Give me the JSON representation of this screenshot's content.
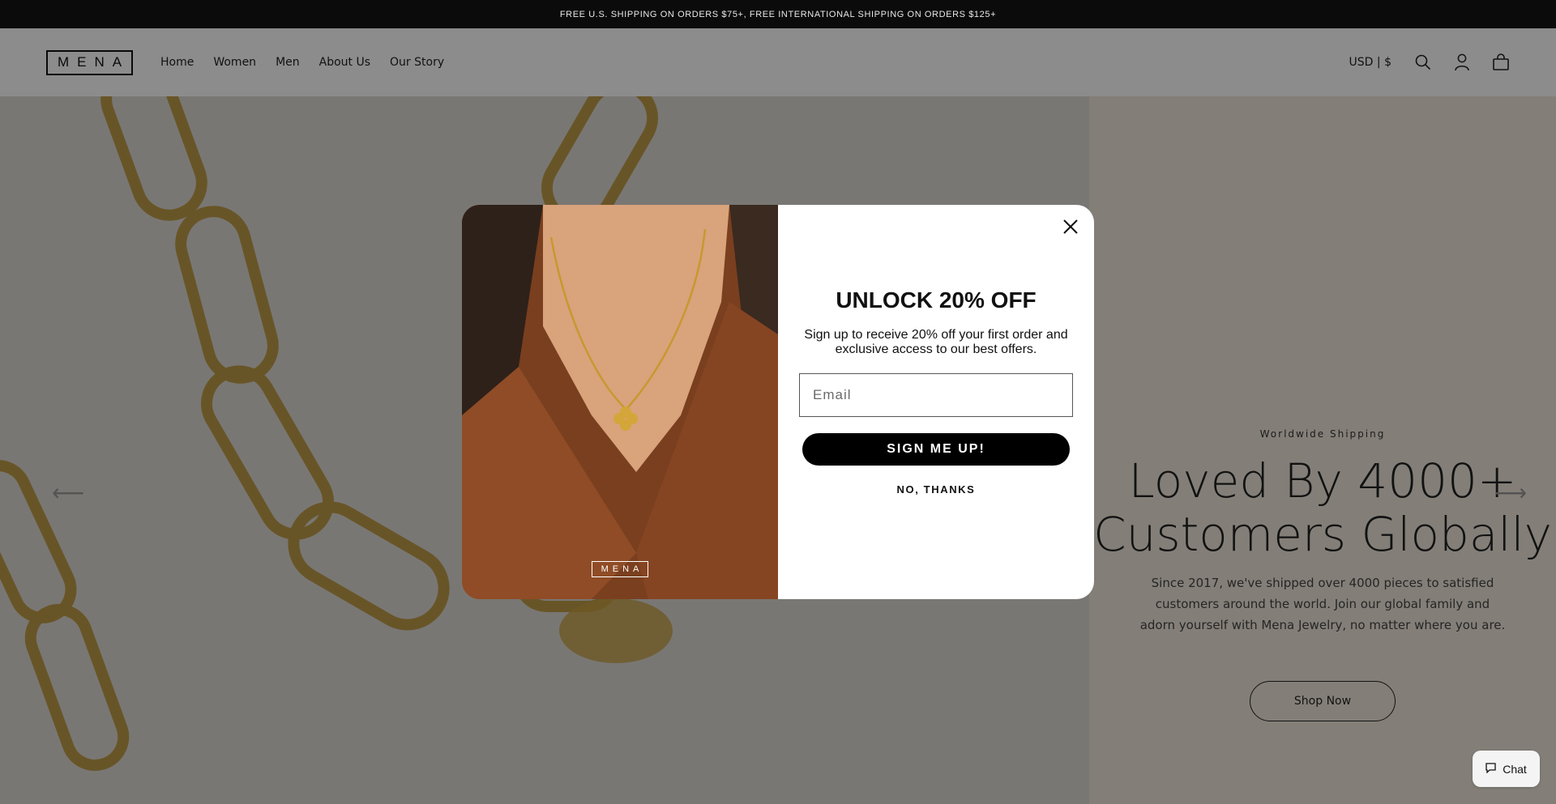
{
  "announcement": "FREE U.S. SHIPPING ON ORDERS $75+, FREE INTERNATIONAL SHIPPING ON ORDERS $125+",
  "header": {
    "logo_text": "MENA",
    "nav": [
      {
        "label": "Home"
      },
      {
        "label": "Women"
      },
      {
        "label": "Men"
      },
      {
        "label": "About Us"
      },
      {
        "label": "Our Story"
      }
    ],
    "currency": "USD | $",
    "icons": [
      "search-icon",
      "account-icon",
      "cart-icon"
    ]
  },
  "hero": {
    "eyebrow": "Worldwide Shipping",
    "title": "Loved By 4000+ Customers Globally",
    "description": "Since 2017, we've shipped over 4000 pieces to satisfied customers around the world. Join our global family and adorn yourself with Mena Jewelry, no matter where you are.",
    "button": "Shop Now"
  },
  "popup": {
    "image_logo": "MENA",
    "heading": "UNLOCK 20% OFF",
    "description": "Sign up to receive 20% off your first order and exclusive access to our best offers.",
    "email_placeholder": "Email",
    "submit_label": "SIGN ME UP!",
    "decline_label": "NO, THANKS"
  },
  "chat": {
    "label": "Chat"
  },
  "colors": {
    "announcement_bg": "#0b0b0b",
    "hero_right_bg": "#efe7db",
    "button_black": "#000000",
    "overlay": "rgba(0,0,0,0.45)"
  }
}
